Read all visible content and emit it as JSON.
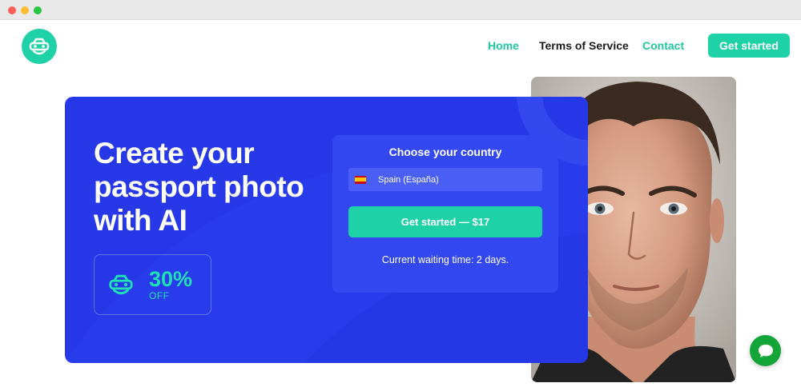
{
  "nav": {
    "home": "Home",
    "terms": "Terms of Service",
    "contact": "Contact",
    "cta": "Get started"
  },
  "hero": {
    "title_line1": "Create your",
    "title_line2": "passport photo",
    "title_line3": "with AI",
    "discount_percent": "30%",
    "discount_off": "OFF"
  },
  "panel": {
    "title": "Choose your country",
    "country": "Spain (España)",
    "cta": "Get started — $17",
    "waiting": "Current waiting time: 2 days."
  },
  "icons": {
    "logo": "car-face-logo-icon",
    "discount": "car-face-icon",
    "flag": "spain-flag-icon",
    "chat": "chat-bubble-icon"
  },
  "colors": {
    "brand": "#1fd1a6",
    "hero_bg": "#2738e8",
    "panel_bg": "#3348f0",
    "chat": "#13a538"
  }
}
